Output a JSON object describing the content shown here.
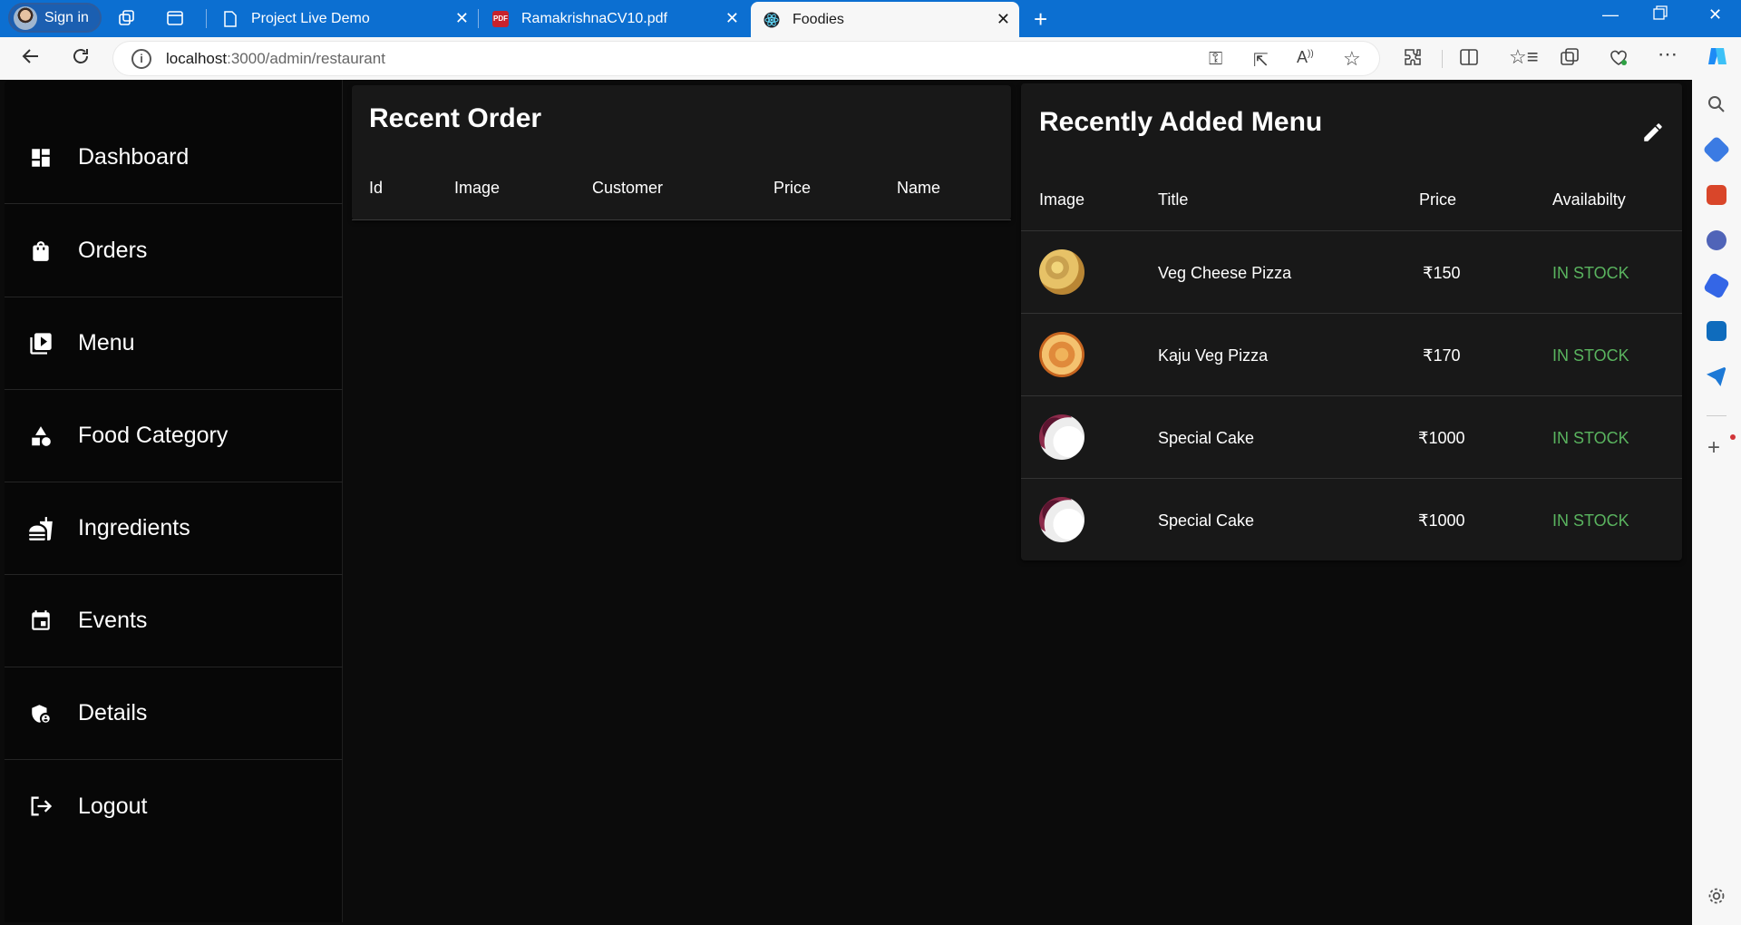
{
  "browser": {
    "signin_label": "Sign in",
    "tabs": [
      {
        "title": "Project Live Demo",
        "icon": "page-icon"
      },
      {
        "title": "RamakrishnaCV10.pdf",
        "icon": "pdf-icon"
      },
      {
        "title": "Foodies",
        "icon": "react-icon",
        "active": true
      }
    ],
    "url_host": "localhost",
    "url_rest": ":3000/admin/restaurant"
  },
  "sidebar": {
    "items": [
      {
        "label": "Dashboard",
        "icon": "dashboard-icon"
      },
      {
        "label": "Orders",
        "icon": "shopping-bag-icon"
      },
      {
        "label": "Menu",
        "icon": "menu-book-icon"
      },
      {
        "label": "Food Category",
        "icon": "category-icon"
      },
      {
        "label": "Ingredients",
        "icon": "fastfood-icon"
      },
      {
        "label": "Events",
        "icon": "calendar-icon"
      },
      {
        "label": "Details",
        "icon": "admin-shield-icon"
      },
      {
        "label": "Logout",
        "icon": "logout-icon"
      }
    ]
  },
  "recent_order": {
    "title": "Recent Order",
    "columns": [
      "Id",
      "Image",
      "Customer",
      "Price",
      "Name"
    ],
    "rows": []
  },
  "recent_menu": {
    "title": "Recently Added Menu",
    "columns": [
      "Image",
      "Title",
      "Price",
      "Availabilty"
    ],
    "rows": [
      {
        "image": "pizza",
        "title": "Veg Cheese Pizza",
        "price": "₹150",
        "status": "IN STOCK"
      },
      {
        "image": "pizza",
        "title": "Kaju Veg Pizza",
        "price": "₹170",
        "status": "IN STOCK"
      },
      {
        "image": "cake",
        "title": "Special Cake",
        "price": "₹1000",
        "status": "IN STOCK"
      },
      {
        "image": "cake",
        "title": "Special Cake",
        "price": "₹1000",
        "status": "IN STOCK"
      }
    ]
  },
  "colors": {
    "in_stock": "#5ab45f",
    "browser_accent": "#0c6fd1"
  }
}
